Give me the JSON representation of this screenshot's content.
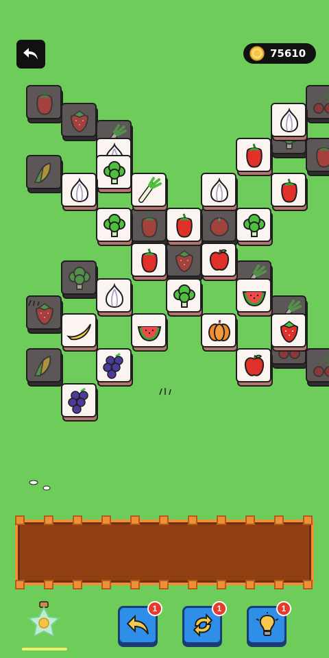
{
  "header": {
    "back_icon": "back-arrow-icon",
    "coin_icon": "gold-coin-icon",
    "coins": "75610"
  },
  "board": {
    "tiles": [
      {
        "col": 0,
        "row": 0,
        "item": "pepper",
        "state": "covered"
      },
      {
        "col": 1,
        "row": 1,
        "item": "strawberry",
        "state": "covered"
      },
      {
        "col": 2,
        "row": 2,
        "item": "leek",
        "state": "covered"
      },
      {
        "col": 0,
        "row": 4,
        "item": "corn",
        "state": "covered"
      },
      {
        "col": 8,
        "row": 0,
        "item": "cherry",
        "state": "covered"
      },
      {
        "col": 7,
        "row": 2,
        "item": "broccoli",
        "state": "covered"
      },
      {
        "col": 8,
        "row": 3,
        "item": "pepper",
        "state": "covered"
      },
      {
        "col": 7,
        "row": 5,
        "item": "broccoli",
        "state": "covered"
      },
      {
        "col": 1,
        "row": 10,
        "item": "broccoli",
        "state": "covered"
      },
      {
        "col": 0,
        "row": 12,
        "item": "strawberry",
        "state": "covered"
      },
      {
        "col": 1,
        "row": 13,
        "item": "leek",
        "state": "covered"
      },
      {
        "col": 0,
        "row": 15,
        "item": "corn",
        "state": "covered"
      },
      {
        "col": 6,
        "row": 10,
        "item": "leek",
        "state": "covered"
      },
      {
        "col": 7,
        "row": 12,
        "item": "leek",
        "state": "covered"
      },
      {
        "col": 7,
        "row": 14,
        "item": "cherry",
        "state": "covered"
      },
      {
        "col": 8,
        "row": 15,
        "item": "cherry",
        "state": "covered"
      },
      {
        "col": 3,
        "row": 7,
        "item": "pepper",
        "state": "covered"
      },
      {
        "col": 5,
        "row": 7,
        "item": "tomato",
        "state": "covered"
      },
      {
        "col": 4,
        "row": 9,
        "item": "strawberry",
        "state": "covered"
      },
      {
        "col": 2,
        "row": 4,
        "item": "broccoli",
        "state": "top"
      },
      {
        "col": 7,
        "row": 1,
        "item": "garlic",
        "state": "top"
      },
      {
        "col": 6,
        "row": 3,
        "item": "pepper",
        "state": "top"
      },
      {
        "col": 2,
        "row": 3,
        "item": "garlic",
        "state": "top"
      },
      {
        "col": 1,
        "row": 5,
        "item": "garlic",
        "state": "top"
      },
      {
        "col": 3,
        "row": 5,
        "item": "leek",
        "state": "top"
      },
      {
        "col": 5,
        "row": 5,
        "item": "garlic",
        "state": "top"
      },
      {
        "col": 7,
        "row": 5,
        "item": "pepper",
        "state": "top"
      },
      {
        "col": 2,
        "row": 7,
        "item": "broccoli",
        "state": "top"
      },
      {
        "col": 4,
        "row": 7,
        "item": "pepper",
        "state": "top"
      },
      {
        "col": 6,
        "row": 7,
        "item": "broccoli",
        "state": "top"
      },
      {
        "col": 3,
        "row": 9,
        "item": "pepper",
        "state": "top"
      },
      {
        "col": 5,
        "row": 9,
        "item": "apple",
        "state": "top"
      },
      {
        "col": 2,
        "row": 11,
        "item": "garlic",
        "state": "top"
      },
      {
        "col": 4,
        "row": 11,
        "item": "broccoli",
        "state": "top"
      },
      {
        "col": 6,
        "row": 11,
        "item": "watermelon",
        "state": "top"
      },
      {
        "col": 1,
        "row": 13,
        "item": "banana",
        "state": "top"
      },
      {
        "col": 3,
        "row": 13,
        "item": "watermelon",
        "state": "top"
      },
      {
        "col": 5,
        "row": 13,
        "item": "pumpkin",
        "state": "top"
      },
      {
        "col": 7,
        "row": 13,
        "item": "strawberry",
        "state": "top"
      },
      {
        "col": 2,
        "row": 15,
        "item": "grapes",
        "state": "top"
      },
      {
        "col": 6,
        "row": 15,
        "item": "apple",
        "state": "top"
      },
      {
        "col": 1,
        "row": 17,
        "item": "grapes",
        "state": "top"
      }
    ]
  },
  "tray": {
    "slots": 7
  },
  "bottom_bar": {
    "bottle_icon": "star-bottle-icon",
    "powerups": [
      {
        "name": "undo",
        "icon": "undo-arrow-icon",
        "count": "1"
      },
      {
        "name": "shuffle",
        "icon": "shuffle-icon",
        "count": "1"
      },
      {
        "name": "hint",
        "icon": "lightbulb-icon",
        "count": "1"
      }
    ]
  },
  "colors": {
    "background": "#6dcc5a",
    "tile_face": "#fbf4f1",
    "tile_side": "#b5746e",
    "tray": "#8f3f12",
    "tray_border": "#ee8f3a",
    "powerup": "#2f8ee8",
    "badge": "#e53a2c"
  }
}
